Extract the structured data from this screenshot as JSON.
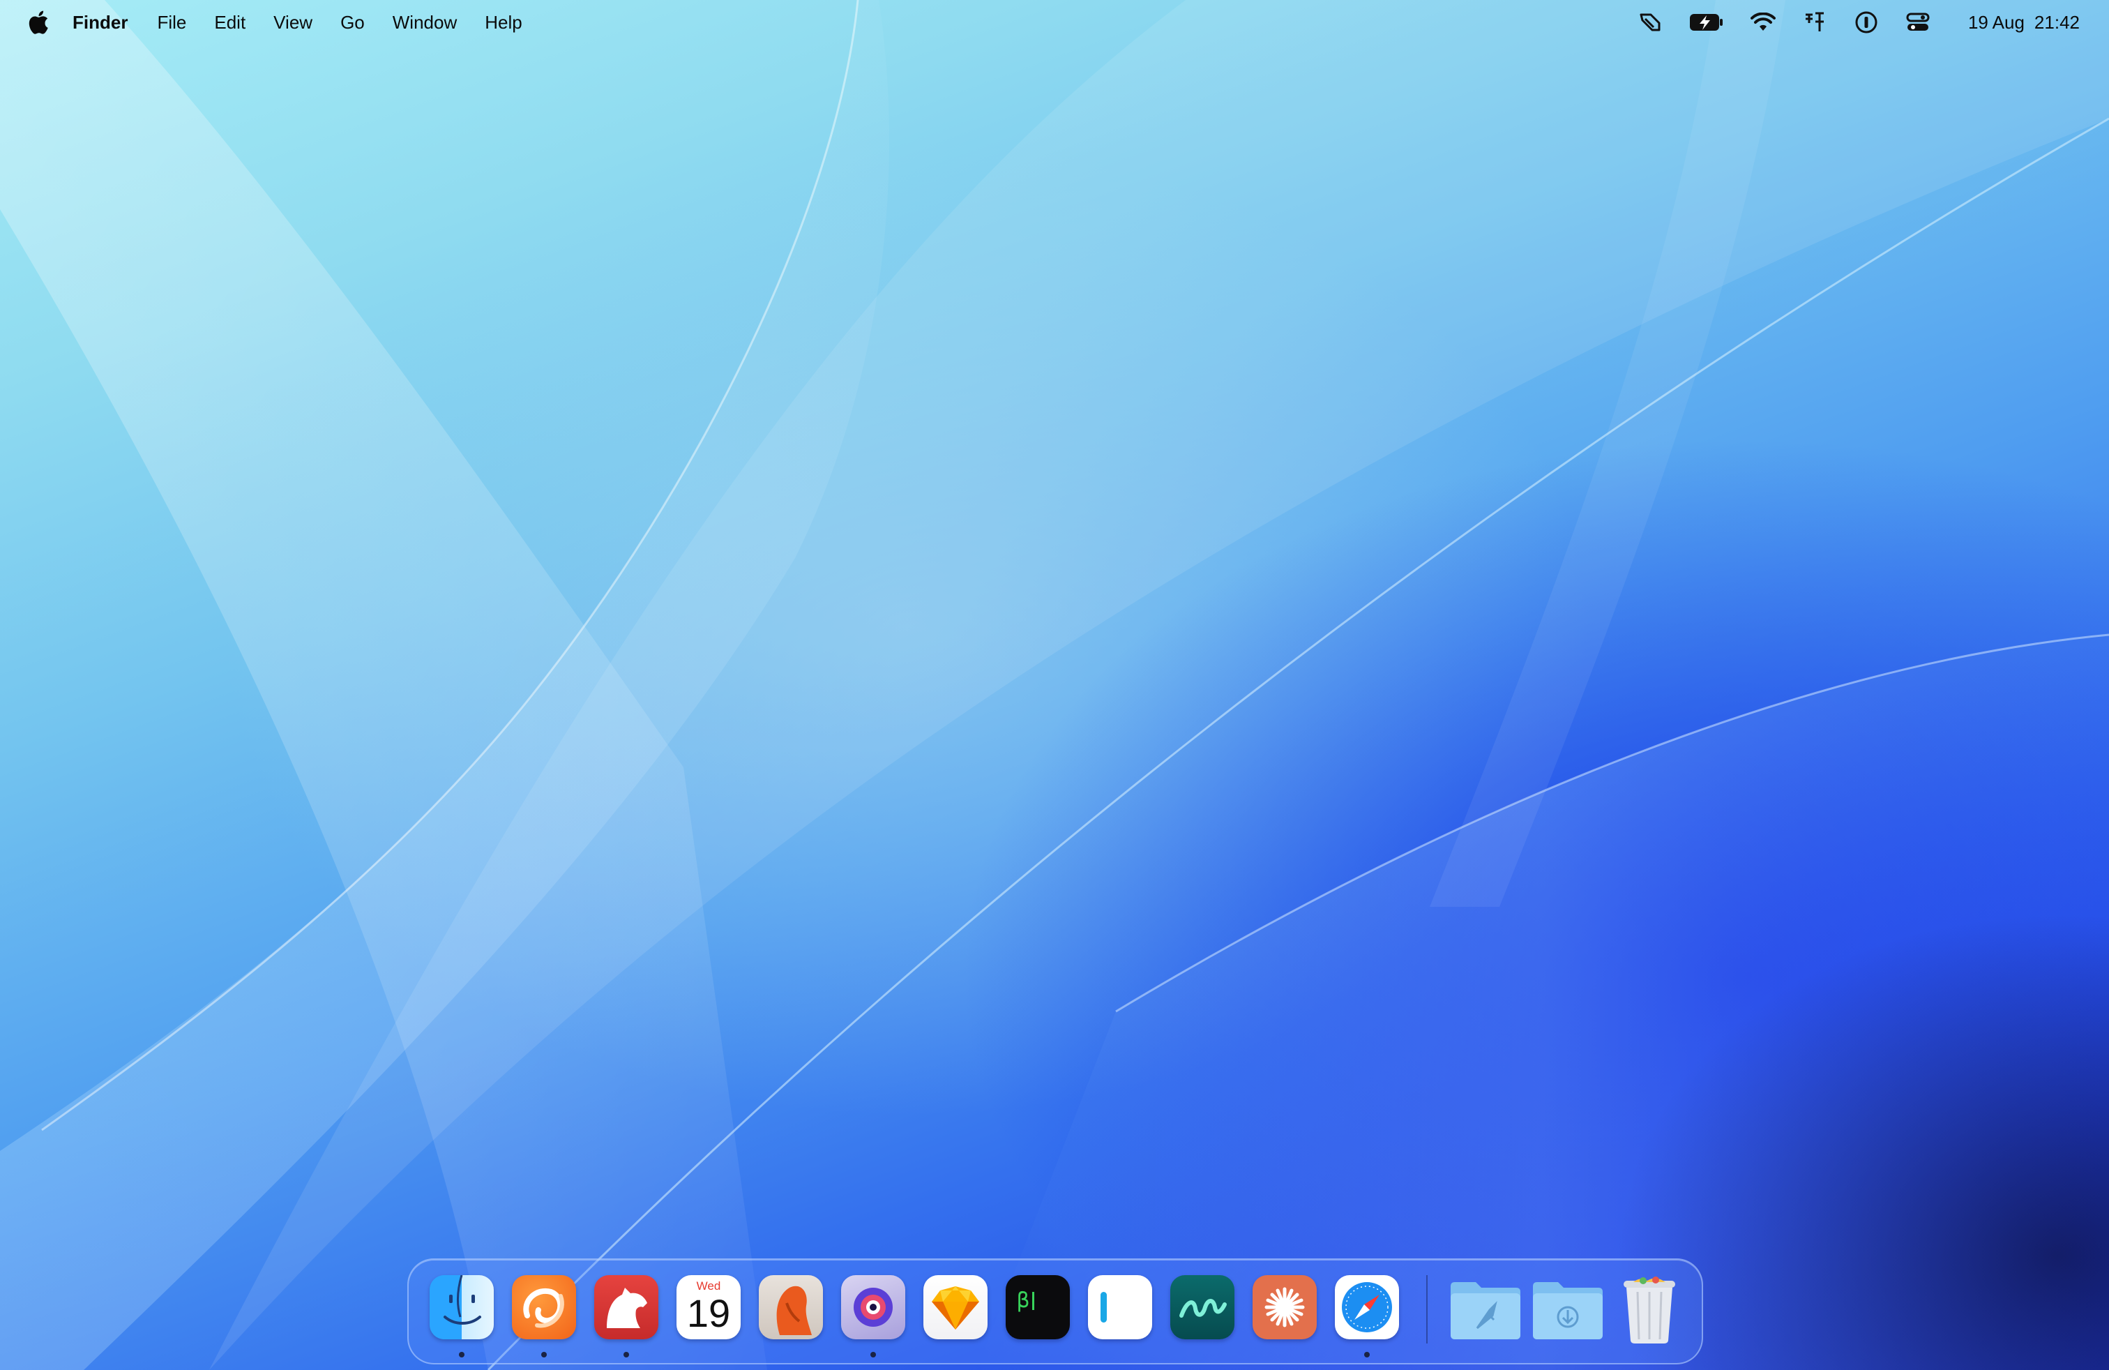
{
  "menubar": {
    "apple_menu_icon": "apple-logo-icon",
    "app_name": "Finder",
    "menus": [
      "File",
      "Edit",
      "View",
      "Go",
      "Window",
      "Help"
    ],
    "status_icons": [
      "hand-pointer-icon",
      "battery-charging-icon",
      "wifi-icon",
      "text-input-icon",
      "password-manager-icon",
      "control-center-icon"
    ],
    "clock": {
      "date": "19 Aug",
      "time": "21:42"
    }
  },
  "dock": {
    "apps": [
      {
        "name": "Finder",
        "icon": "finder-icon",
        "running": true
      },
      {
        "name": "Orange swirl app",
        "icon": "orange-swirl-icon",
        "running": true
      },
      {
        "name": "Bear",
        "icon": "bear-icon",
        "running": true
      },
      {
        "name": "Calendar",
        "icon": "calendar-icon",
        "running": false,
        "day_label": "Wed",
        "date_label": "19"
      },
      {
        "name": "Orange figure app",
        "icon": "orange-figure-icon",
        "running": false
      },
      {
        "name": "Purple eye app",
        "icon": "purple-eye-icon",
        "running": true
      },
      {
        "name": "Sketch",
        "icon": "sketch-diamond-icon",
        "running": false
      },
      {
        "name": "Terminal beta",
        "icon": "terminal-beta-icon",
        "running": false,
        "label": "β"
      },
      {
        "name": "Notes bar app",
        "icon": "white-bar-icon",
        "running": false
      },
      {
        "name": "Freeform",
        "icon": "squiggle-icon",
        "running": false
      },
      {
        "name": "Claude",
        "icon": "asterisk-burst-icon",
        "running": false
      },
      {
        "name": "Safari",
        "icon": "safari-compass-icon",
        "running": true
      }
    ],
    "stacks": [
      {
        "name": "Applications",
        "icon": "applications-folder-icon"
      },
      {
        "name": "Downloads",
        "icon": "downloads-folder-icon"
      },
      {
        "name": "Trash",
        "icon": "trash-icon"
      }
    ]
  },
  "colors": {
    "wallpaper_top": "#a6ecf6",
    "wallpaper_bottom": "#1b2fc4",
    "dock_dot": "#1a2344"
  }
}
